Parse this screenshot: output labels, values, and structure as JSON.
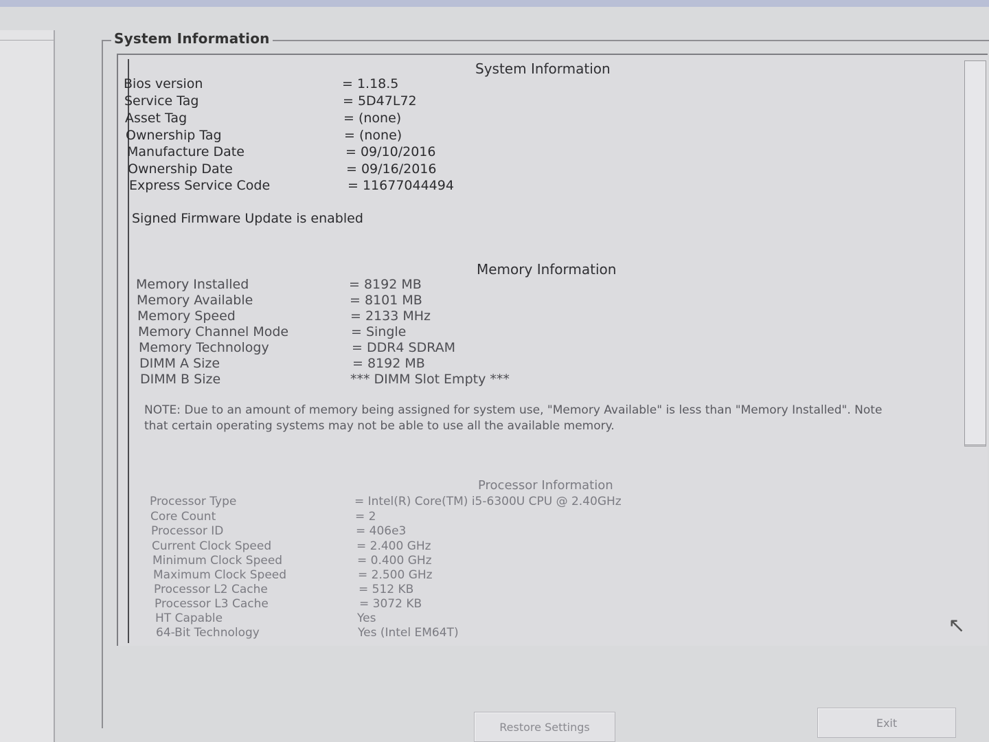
{
  "group_title": "System Information",
  "system": {
    "title": "System Information",
    "rows": [
      {
        "label": "Bios version",
        "value": "= 1.18.5"
      },
      {
        "label": "Service Tag",
        "value": "= 5D47L72"
      },
      {
        "label": "Asset Tag",
        "value": "= (none)"
      },
      {
        "label": "Ownership Tag",
        "value": "= (none)"
      },
      {
        "label": "Manufacture Date",
        "value": "= 09/10/2016"
      },
      {
        "label": "Ownership Date",
        "value": "= 09/16/2016"
      },
      {
        "label": "Express Service Code",
        "value": "= 11677044494"
      }
    ],
    "firmware_message": "Signed Firmware Update is enabled"
  },
  "memory": {
    "title": "Memory Information",
    "rows": [
      {
        "label": "Memory Installed",
        "value": "= 8192 MB"
      },
      {
        "label": "Memory Available",
        "value": "= 8101 MB"
      },
      {
        "label": "Memory Speed",
        "value": "= 2133 MHz"
      },
      {
        "label": "Memory Channel Mode",
        "value": "= Single"
      },
      {
        "label": "Memory Technology",
        "value": "= DDR4 SDRAM"
      },
      {
        "label": "DIMM A Size",
        "value": "= 8192 MB"
      },
      {
        "label": "DIMM B Size",
        "value": "*** DIMM Slot Empty ***"
      }
    ],
    "note": "NOTE: Due to an amount of memory being assigned for system use, \"Memory Available\" is less than \"Memory Installed\". Note that certain operating systems may not be able to use all the available memory."
  },
  "processor": {
    "title": "Processor Information",
    "rows": [
      {
        "label": "Processor Type",
        "value": "= Intel(R) Core(TM) i5-6300U CPU @ 2.40GHz"
      },
      {
        "label": "Core Count",
        "value": "= 2"
      },
      {
        "label": "Processor ID",
        "value": "= 406e3"
      },
      {
        "label": "Current Clock Speed",
        "value": "= 2.400 GHz"
      },
      {
        "label": "Minimum Clock Speed",
        "value": "= 0.400 GHz"
      },
      {
        "label": "Maximum Clock Speed",
        "value": "= 2.500 GHz"
      },
      {
        "label": "Processor L2 Cache",
        "value": "= 512 KB"
      },
      {
        "label": "Processor L3 Cache",
        "value": "= 3072 KB"
      },
      {
        "label": "HT Capable",
        "value": "Yes"
      },
      {
        "label": "64-Bit Technology",
        "value": "Yes (Intel EM64T)"
      }
    ]
  },
  "buttons": {
    "restore": "Restore Settings",
    "exit": "Exit"
  },
  "icons": {
    "cursor": "pointer-cursor-icon"
  }
}
